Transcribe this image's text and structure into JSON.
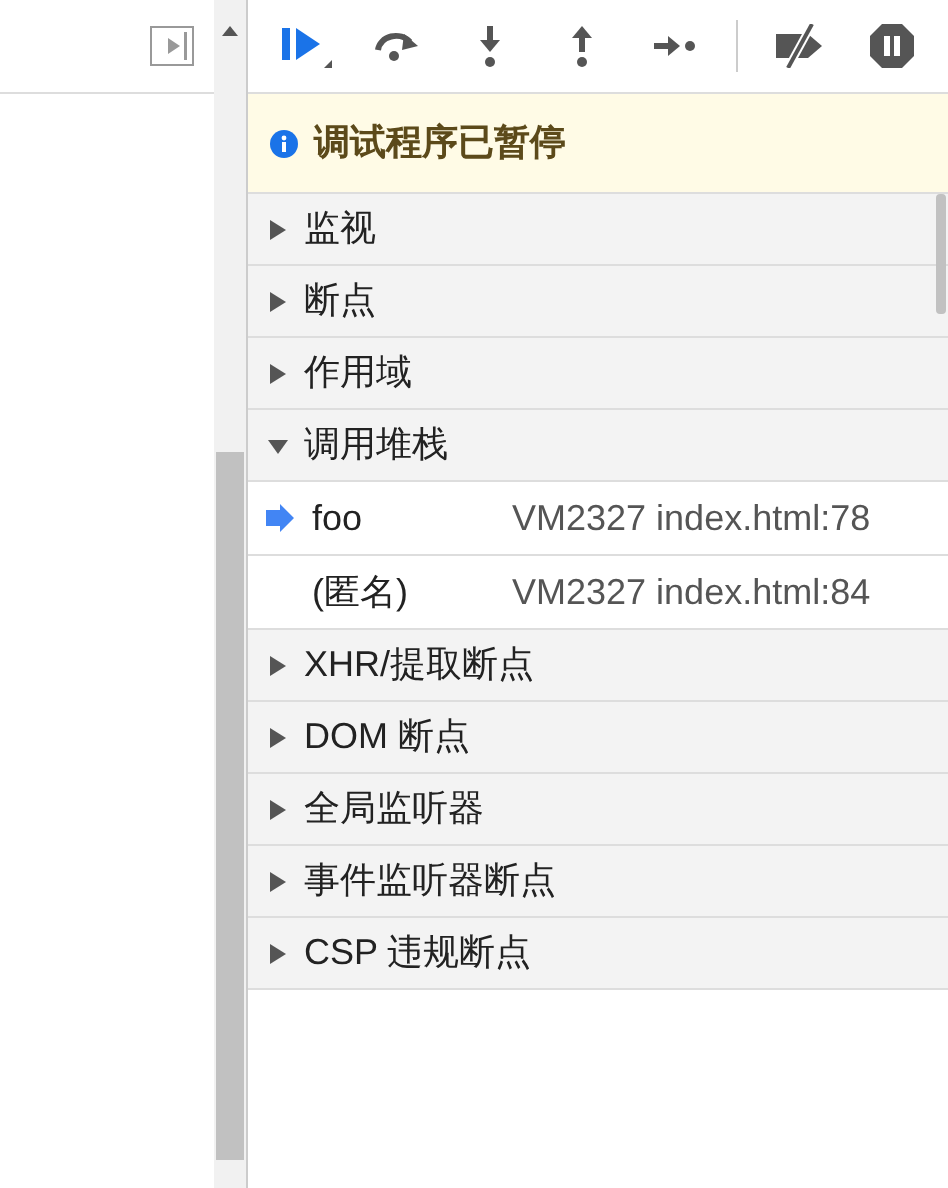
{
  "banner": {
    "text": "调试程序已暂停"
  },
  "sections": [
    {
      "title": "监视",
      "expanded": false
    },
    {
      "title": "断点",
      "expanded": false
    },
    {
      "title": "作用域",
      "expanded": false
    },
    {
      "title": "调用堆栈",
      "expanded": true,
      "frames": [
        {
          "name": "foo",
          "location": "VM2327 index.html:78",
          "selected": true
        },
        {
          "name": "(匿名)",
          "location": "VM2327 index.html:84",
          "selected": false
        }
      ]
    },
    {
      "title": "XHR/提取断点",
      "expanded": false
    },
    {
      "title": "DOM 断点",
      "expanded": false
    },
    {
      "title": "全局监听器",
      "expanded": false
    },
    {
      "title": "事件监听器断点",
      "expanded": false
    },
    {
      "title": "CSP 违规断点",
      "expanded": false
    }
  ]
}
